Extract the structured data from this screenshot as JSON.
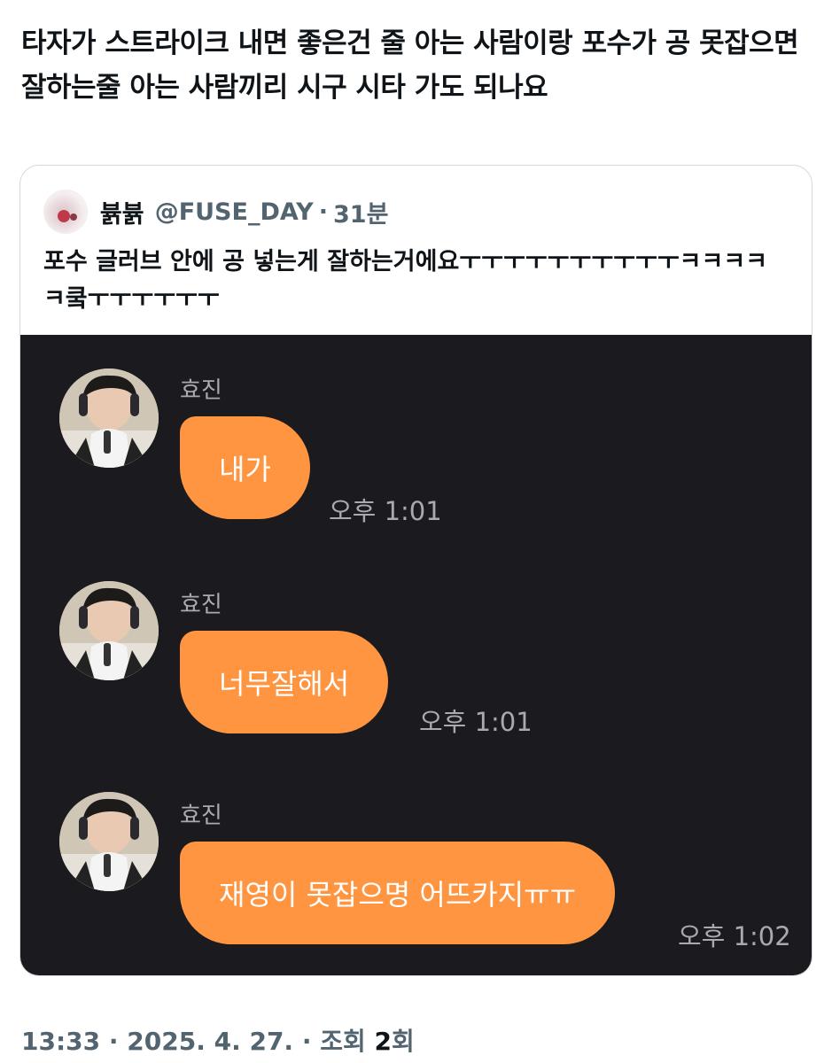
{
  "post": {
    "text": "타자가 스트라이크 내면 좋은건 줄 아는 사람이랑 포수가 공 못잡으면 잘하는줄 아는 사람끼리 시구 시타 가도 되나요"
  },
  "quoted_post": {
    "author_name": "뷹뷹",
    "handle": "@FUSE_DAY",
    "separator": "·",
    "time": "31분",
    "text": "포수 글러브 안에 공 넣는게 잘하는거에요ㅜㅜㅜㅜㅜㅜㅜㅜㅜㅜㅋㅋㅋㅋㅋ쿸ㅜㅜㅜㅜㅜㅜ",
    "chat_screenshot": {
      "messages": [
        {
          "sender": "효진",
          "text": "내가",
          "time": "오후 1:01"
        },
        {
          "sender": "효진",
          "text": "너무잘해서",
          "time": "오후 1:01"
        },
        {
          "sender": "효진",
          "text": "재영이 못잡으명 어뜨카지ㅠㅠ",
          "time": "오후 1:02"
        }
      ]
    }
  },
  "footer": {
    "time": "13:33",
    "sep1": "·",
    "date": "2025. 4. 27.",
    "sep2": "·",
    "views_label": "조회",
    "views_count": "2",
    "views_suffix": "회"
  },
  "colors": {
    "bubble": "#ff9540",
    "chat_background": "#1b1b1f",
    "meta_text": "#536471"
  }
}
